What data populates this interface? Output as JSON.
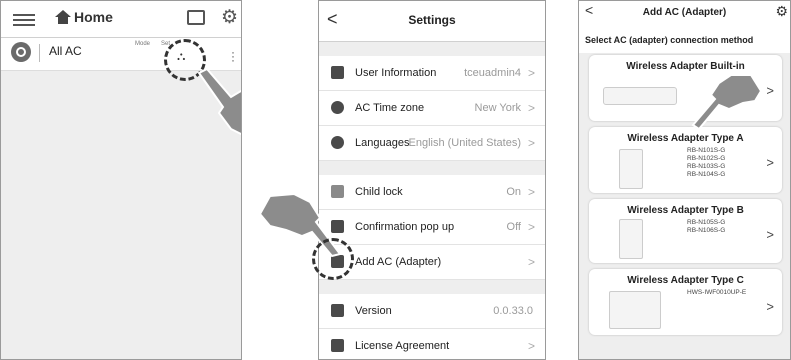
{
  "phone1": {
    "header": {
      "home_label": "Home",
      "menu_icon": "hamburger-menu-icon",
      "device_icon": "device-icon",
      "gear_icon": "gear-icon"
    },
    "row": {
      "label": "All AC",
      "mode_label": "Mode",
      "set_label": "Set"
    }
  },
  "phone2": {
    "title": "Settings",
    "items": [
      {
        "label": "User Information",
        "value": "tceuadmin4",
        "icon": "user-icon"
      },
      {
        "label": "AC Time zone",
        "value": "New York",
        "icon": "clock-icon"
      },
      {
        "label": "Languages",
        "value": "English (United States)",
        "icon": "globe-icon"
      },
      {
        "label": "Child lock",
        "value": "On",
        "icon": "lock-icon"
      },
      {
        "label": "Confirmation pop up",
        "value": "Off",
        "icon": "chat-icon"
      },
      {
        "label": "Add AC (Adapter)",
        "value": "",
        "icon": "adapter-icon"
      },
      {
        "label": "Version",
        "value": "0.0.33.0",
        "icon": "info-icon"
      },
      {
        "label": "License Agreement",
        "value": "",
        "icon": "document-icon"
      }
    ]
  },
  "phone3": {
    "title": "Add AC (Adapter)",
    "subtitle": "Select AC (adapter) connection method",
    "cards": [
      {
        "title": "Wireless Adapter Built-in",
        "models": []
      },
      {
        "title": "Wireless Adapter Type A",
        "models": [
          "RB-N101S-G",
          "RB-N102S-G",
          "RB-N103S-G",
          "RB-N104S-G"
        ]
      },
      {
        "title": "Wireless Adapter Type B",
        "models": [
          "RB-N105S-G",
          "RB-N106S-G"
        ]
      },
      {
        "title": "Wireless Adapter Type C",
        "models": [
          "HWS-IWF0010UP-E"
        ]
      }
    ]
  }
}
